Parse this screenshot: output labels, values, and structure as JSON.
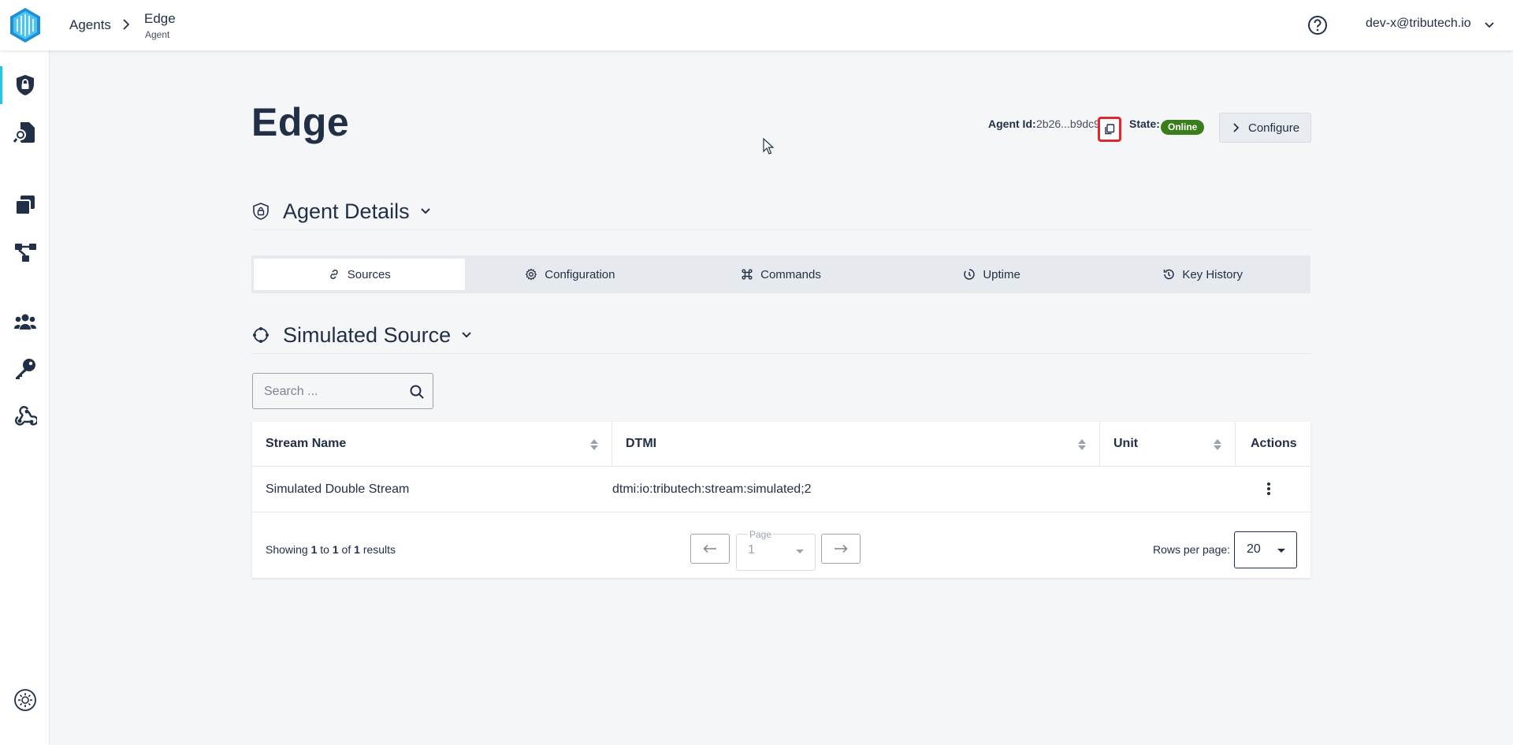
{
  "header": {
    "breadcrumb_root": "Agents",
    "breadcrumb_current": "Edge",
    "breadcrumb_current_sub": "Agent",
    "user": "dev-x@tributech.io"
  },
  "sidebar": {
    "items": [
      {
        "name": "agents",
        "icon": "shield-lock-icon",
        "active": true
      },
      {
        "name": "sources",
        "icon": "file-search-icon"
      },
      {
        "name": "catalog",
        "icon": "stacked-cards-icon"
      },
      {
        "name": "network",
        "icon": "node-graph-icon"
      },
      {
        "name": "users",
        "icon": "users-group-icon"
      },
      {
        "name": "keys",
        "icon": "key-icon"
      },
      {
        "name": "webhooks",
        "icon": "webhook-icon"
      }
    ],
    "theme_toggle": "sun-icon"
  },
  "agent": {
    "title": "Edge",
    "id_label": "Agent Id:",
    "id_value": "2b26...b9dc9",
    "state_label": "State:",
    "state_value": "Online",
    "configure_label": "Configure"
  },
  "details": {
    "title": "Agent Details"
  },
  "tabs": [
    {
      "label": "Sources",
      "icon": "link-icon",
      "active": true
    },
    {
      "label": "Configuration",
      "icon": "gear-icon"
    },
    {
      "label": "Commands",
      "icon": "command-icon"
    },
    {
      "label": "Uptime",
      "icon": "timer-icon"
    },
    {
      "label": "Key History",
      "icon": "history-icon"
    }
  ],
  "source": {
    "title": "Simulated Source",
    "search_placeholder": "Search ..."
  },
  "table": {
    "columns": [
      "Stream Name",
      "DTMI",
      "Unit",
      "Actions"
    ],
    "rows": [
      {
        "stream_name": "Simulated Double Stream",
        "dtmi": "dtmi:io:tributech:stream:simulated;2",
        "unit": ""
      }
    ],
    "showing_prefix": "Showing",
    "showing_from": "1",
    "showing_to_word": "to",
    "showing_to": "1",
    "showing_of_word": "of",
    "showing_total": "1",
    "showing_suffix": "results",
    "page_label": "Page",
    "page_value": "1",
    "rows_per_page_label": "Rows per page:",
    "rows_per_page_value": "20"
  },
  "colors": {
    "accent": "#1ec8e6",
    "online": "#3a7d1b",
    "highlight": "#e4262b",
    "text": "#223047"
  }
}
